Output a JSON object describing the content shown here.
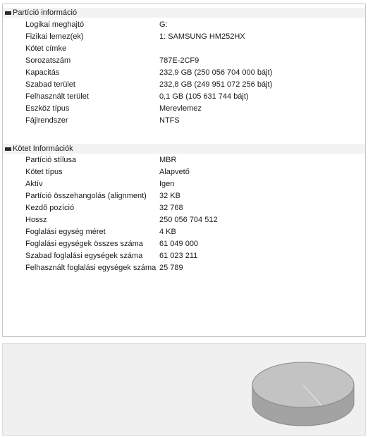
{
  "partition_info": {
    "title": "Partíció információ",
    "rows": [
      {
        "label": "Logikai meghajtó",
        "value": "G:"
      },
      {
        "label": "Fizikai lemez(ek)",
        "value": "1: SAMSUNG HM252HX"
      },
      {
        "label": "Kötet címke",
        "value": ""
      },
      {
        "label": "Sorozatszám",
        "value": "787E-2CF9"
      },
      {
        "label": "Kapacitás",
        "value": "232,9 GB (250 056 704 000 bájt)"
      },
      {
        "label": "Szabad terület",
        "value": "232,8 GB (249 951 072 256 bájt)"
      },
      {
        "label": "Felhasznált terület",
        "value": "0,1 GB (105 631 744 bájt)"
      },
      {
        "label": "Eszköz típus",
        "value": "Merevlemez"
      },
      {
        "label": "Fájlrendszer",
        "value": "NTFS"
      }
    ]
  },
  "volume_info": {
    "title": "Kötet Információk",
    "rows": [
      {
        "label": "Partíció stílusa",
        "value": "MBR"
      },
      {
        "label": "Kötet típus",
        "value": "Alapvető"
      },
      {
        "label": "Aktív",
        "value": "Igen"
      },
      {
        "label": "Partíció összehangolás (alignment)",
        "value": "32 KB"
      },
      {
        "label": "Kezdő pozíció",
        "value": "32 768"
      },
      {
        "label": "Hossz",
        "value": "250 056 704 512"
      },
      {
        "label": "Foglalási egység méret",
        "value": "4 KB"
      },
      {
        "label": "Foglalási egységek összes száma",
        "value": "61 049 000"
      },
      {
        "label": "Szabad foglalási egységek száma",
        "value": "61 023 211"
      },
      {
        "label": "Felhasznált foglalási egységek száma",
        "value": "25 789"
      }
    ]
  },
  "disk_usage_pie": {
    "used_fraction": 0.000422,
    "colors": {
      "top": "#c3c3c3",
      "side": "#a3a3a3",
      "edge": "#8a8a8a",
      "panel_bg": "#f0f0f0"
    }
  }
}
